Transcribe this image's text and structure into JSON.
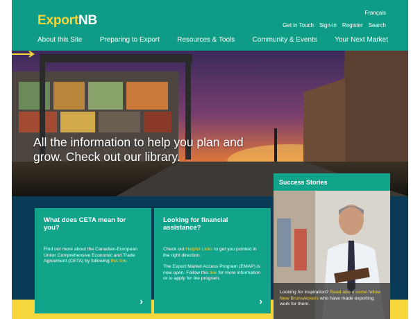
{
  "header": {
    "logo_part1": "Export",
    "logo_part2": "NB",
    "language": "Français",
    "utility": [
      "Get in Touch",
      "Sign-in",
      "Register",
      "Search"
    ],
    "nav": [
      "About this Site",
      "Preparing to Export",
      "Resources & Tools",
      "Community & Events",
      "Your Next Market"
    ]
  },
  "hero": {
    "text": "All the information to help you plan and grow. Check out our library."
  },
  "card_ceta": {
    "title": "What does CETA mean for you?",
    "body_before": "Find out more about the Canadian-European Union Comprehensive Economic and Trade Agreement (CETA) by following ",
    "link": "this link",
    "body_after": "."
  },
  "card_finance": {
    "title": "Looking for financial assistance?",
    "p1_before": "Check out ",
    "p1_link": "Helpful Links",
    "p1_after": " to get you pointed in the right direction.",
    "p2_before": "The Export Market Access Program (EMAP) is now open. Follow this ",
    "p2_link": "link",
    "p2_after": " for more information or to apply for the program."
  },
  "success": {
    "title": "Success Stories",
    "cap_before": "Looking for inspiration? ",
    "cap_link": "Read about some fellow New Brunswickers",
    "cap_after": " who have made exporting work for them."
  },
  "icons": {
    "chevron": "›",
    "arrow": "right-arrow-icon"
  },
  "colors": {
    "header": "#0f9c86",
    "accent": "#f5d63c",
    "card": "#12a38b",
    "band": "#0b3a57"
  }
}
